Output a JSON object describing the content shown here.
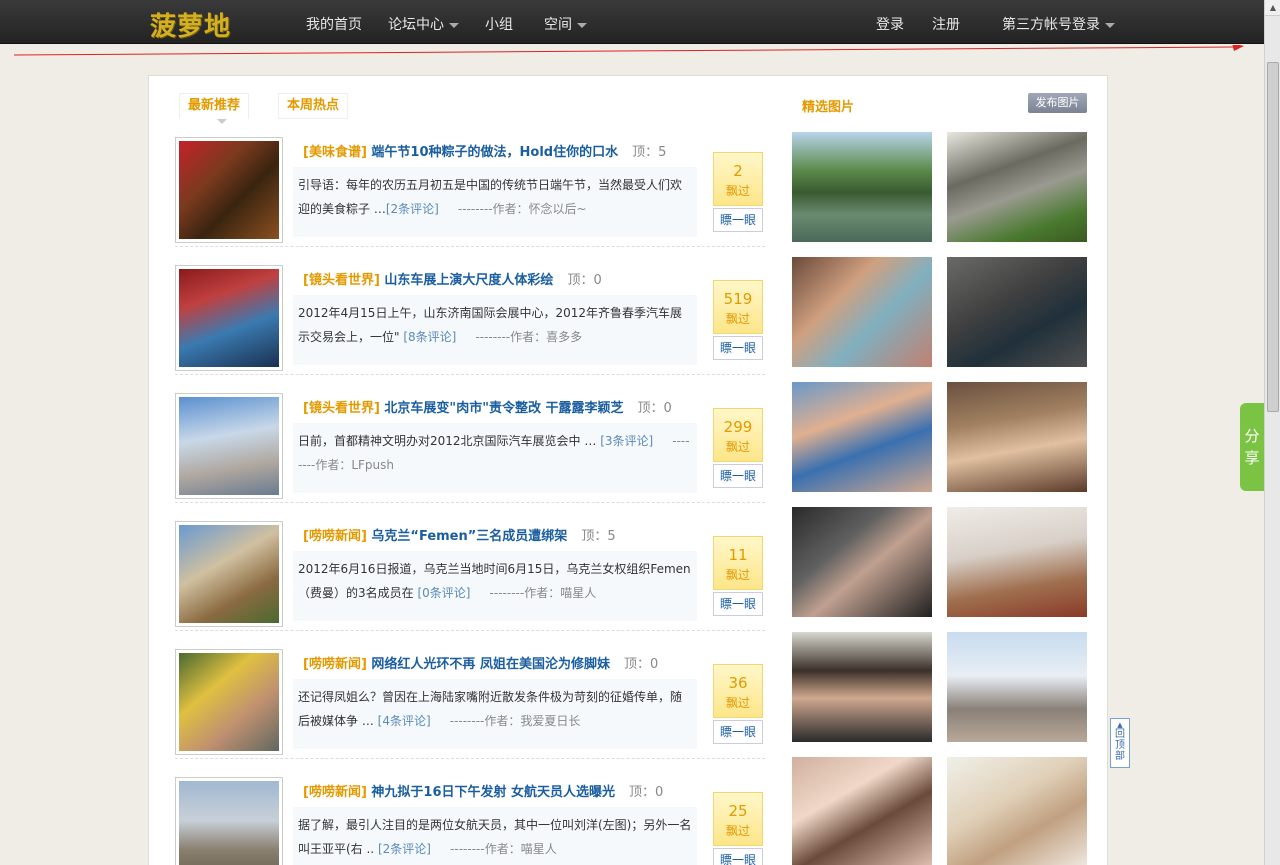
{
  "topnav": {
    "logo": "菠萝地",
    "items": [
      "我的首页",
      "论坛中心",
      "小组",
      "空间"
    ],
    "login": "登录",
    "register": "注册",
    "third_party": "第三方帐号登录"
  },
  "tabs": [
    "最新推荐",
    "本周热点"
  ],
  "articles": [
    {
      "category": "[美味食谱]",
      "title": "端午节10种粽子的做法，Hold住你的口水",
      "top": "顶：5",
      "summary": "引导语：每年的农历五月初五是中国的传统节日端午节，当然最受人们欢迎的美食粽子 …",
      "comments": "[2条评论]",
      "author": "--------作者：怀念以后~",
      "count": "2",
      "count_label": "飘过",
      "peek": "瞟一眼"
    },
    {
      "category": "[镜头看世界]",
      "title": "山东车展上演大尺度人体彩绘",
      "top": "顶：0",
      "summary": "2012年4月15日上午，山东济南国际会展中心，2012年齐鲁春季汽车展示交易会上，一位\"",
      "comments": "[8条评论]",
      "author": "--------作者：喜多多",
      "count": "519",
      "count_label": "飘过",
      "peek": "瞟一眼"
    },
    {
      "category": "[镜头看世界]",
      "title": "北京车展变\"肉市\"责令整改 干露露李颖芝",
      "top": "顶：0",
      "summary": "日前，首都精神文明办对2012北京国际汽车展览会中 …",
      "comments": "[3条评论]",
      "author": "--------作者：LFpush",
      "count": "299",
      "count_label": "飘过",
      "peek": "瞟一眼"
    },
    {
      "category": "[唠唠新闻]",
      "title": "乌克兰“Femen”三名成员遭绑架",
      "top": "顶：5",
      "summary": "2012年6月16日报道，乌克兰当地时间6月15日，乌克兰女权组织Femen（费曼）的3名成员在",
      "comments": "[0条评论]",
      "author": "--------作者：喵星人",
      "count": "11",
      "count_label": "飘过",
      "peek": "瞟一眼"
    },
    {
      "category": "[唠唠新闻]",
      "title": "网络红人光环不再 凤姐在美国沦为修脚妹",
      "top": "顶：0",
      "summary": "还记得凤姐么？曾因在上海陆家嘴附近散发条件极为苛刻的征婚传单，随后被媒体争 …",
      "comments": "[4条评论]",
      "author": "--------作者：我爱夏日长",
      "count": "36",
      "count_label": "飘过",
      "peek": "瞟一眼"
    },
    {
      "category": "[唠唠新闻]",
      "title": "神九拟于16日下午发射 女航天员人选曝光",
      "top": "顶：0",
      "summary": "据了解，最引人注目的是两位女航天员，其中一位叫刘洋(左图)；另外一名叫王亚平(右 ..",
      "comments": "[2条评论]",
      "author": "--------作者：喵星人",
      "count": "25",
      "count_label": "飘过",
      "peek": "瞟一眼"
    }
  ],
  "sidebar": {
    "title": "精选图片",
    "publish": "发布图片"
  },
  "share": "分享",
  "back_top": "回顶部",
  "colors": {
    "accent": "#e39a00",
    "link": "#1b5ea0",
    "nav_bg": "#2b2b2b",
    "share_green": "#7bc443"
  }
}
